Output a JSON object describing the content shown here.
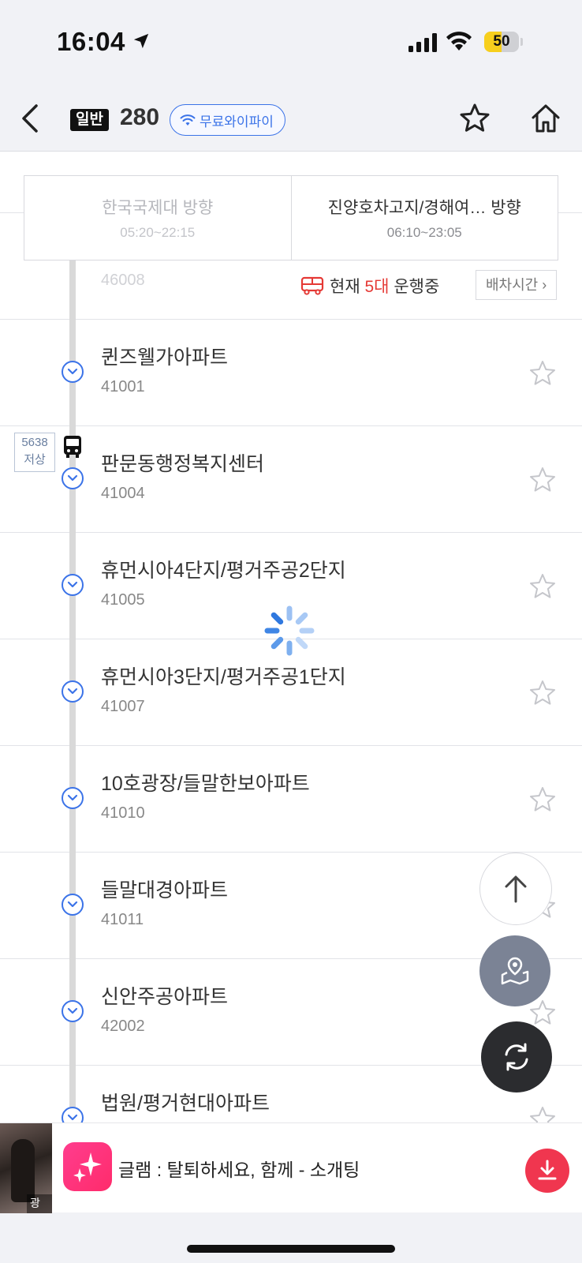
{
  "status": {
    "time": "16:04",
    "battery": "50",
    "battery_level": 0.5
  },
  "header": {
    "type_badge": "일반",
    "route_number": "280",
    "wifi_label": "무료와이파이"
  },
  "directions": [
    {
      "name": "한국국제대 방향",
      "hours": "05:20~22:15",
      "active": false
    },
    {
      "name": "진양호차고지/경해여… 방향",
      "hours": "06:10~23:05",
      "active": true
    }
  ],
  "operating": {
    "prefix": "현재",
    "count": "5대",
    "suffix": "운행중",
    "schedule_button": "배차시간"
  },
  "partial_stop_id": "46008",
  "stops": [
    {
      "name": "퀸즈웰가아파트",
      "id": "41001"
    },
    {
      "name": "판문동행정복지센터",
      "id": "41004"
    },
    {
      "name": "휴먼시아4단지/평거주공2단지",
      "id": "41005"
    },
    {
      "name": "휴먼시아3단지/평거주공1단지",
      "id": "41007"
    },
    {
      "name": "10호광장/들말한보아파트",
      "id": "41010"
    },
    {
      "name": "들말대경아파트",
      "id": "41011"
    },
    {
      "name": "신안주공아파트",
      "id": "42002"
    },
    {
      "name": "법원/평거현대아파트",
      "id": ""
    }
  ],
  "bus": {
    "number": "5638",
    "type": "저상"
  },
  "ad": {
    "label": "광고",
    "text": "글램 : 탈퇴하세요, 함께 - 소개팅"
  },
  "colors": {
    "accent": "#3b73e8",
    "alert": "#e53935",
    "download": "#f0364f",
    "battery": "#f7cf1d"
  }
}
